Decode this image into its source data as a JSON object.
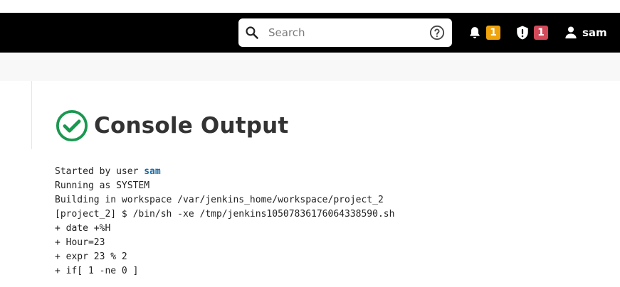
{
  "colors": {
    "header_bg": "#000000",
    "notification_badge": "#f0a30a",
    "security_badge": "#d24a5a",
    "success_green": "#1a9850",
    "link_blue": "#1a6ca8"
  },
  "header": {
    "search": {
      "placeholder": "Search",
      "value": ""
    },
    "notifications": {
      "icon": "bell-icon",
      "count": "1"
    },
    "security": {
      "icon": "shield-alert-icon",
      "count": "1"
    },
    "user": {
      "icon": "person-icon",
      "name": "sam"
    }
  },
  "page": {
    "status_icon": "success-check-icon",
    "title": "Console Output"
  },
  "console": {
    "started_prefix": "Started by user ",
    "started_user": "sam",
    "lines": [
      "Running as SYSTEM",
      "Building in workspace /var/jenkins_home/workspace/project_2",
      "[project_2] $ /bin/sh -xe /tmp/jenkins10507836176064338590.sh",
      "+ date +%H",
      "+ Hour=23",
      "+ expr 23 % 2",
      "+ if[ 1 -ne 0 ]"
    ]
  }
}
